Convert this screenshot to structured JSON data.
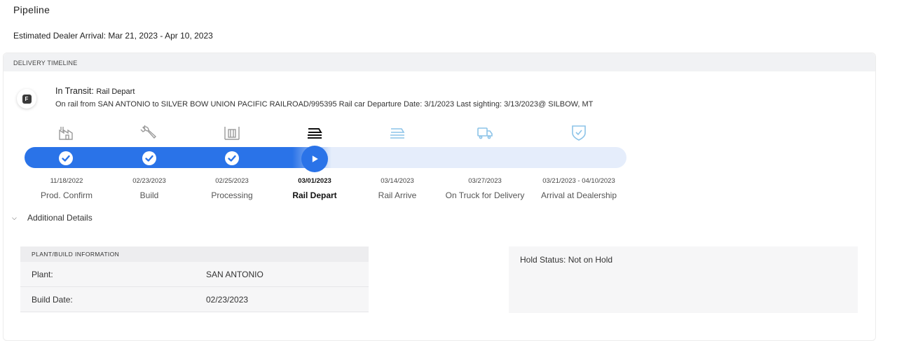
{
  "page": {
    "title": "Pipeline",
    "arrival_label": "Estimated Dealer Arrival: Mar 21, 2023 - Apr 10, 2023"
  },
  "timeline_card": {
    "header": "DELIVERY TIMELINE",
    "badge_letter": "F",
    "status_prefix": "In Transit: ",
    "status_stage": "Rail Depart",
    "status_detail": "On rail from SAN ANTONIO to SILVER BOW UNION PACIFIC RAILROAD/995395 Rail car Departure Date: 3/1/2023 Last sighting: 3/13/2023@ SILBOW, MT",
    "accent_color": "#2a73e8",
    "steps": [
      {
        "date": "11/18/2022",
        "label": "Prod. Confirm",
        "state": "done",
        "icon": "factory-icon"
      },
      {
        "date": "02/23/2023",
        "label": "Build",
        "state": "done",
        "icon": "wrench-icon"
      },
      {
        "date": "02/25/2023",
        "label": "Processing",
        "state": "done",
        "icon": "processing-icon"
      },
      {
        "date": "03/01/2023",
        "label": "Rail Depart",
        "state": "current",
        "icon": "rail-icon"
      },
      {
        "date": "03/14/2023",
        "label": "Rail Arrive",
        "state": "pending",
        "icon": "rail-arrive-icon"
      },
      {
        "date": "03/27/2023",
        "label": "On Truck for Delivery",
        "state": "pending",
        "icon": "truck-icon"
      },
      {
        "date": "03/21/2023 - 04/10/2023",
        "label": "Arrival at Dealership",
        "state": "pending",
        "icon": "shield-check-icon"
      }
    ],
    "additional_details_label": "Additional Details"
  },
  "plant_info": {
    "header": "PLANT/BUILD INFORMATION",
    "rows": [
      {
        "key": "Plant:",
        "value": "SAN ANTONIO"
      },
      {
        "key": "Build Date:",
        "value": "02/23/2023"
      }
    ]
  },
  "hold": {
    "status": "Hold Status: Not on Hold"
  }
}
